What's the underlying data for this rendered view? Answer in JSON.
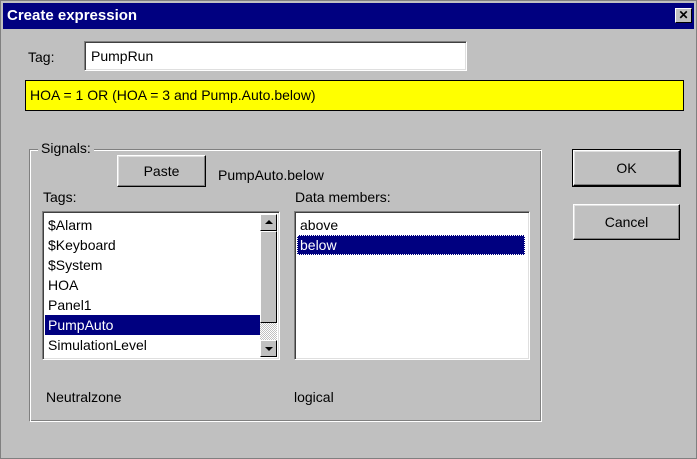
{
  "dialog": {
    "title": "Create expression",
    "close_glyph": "✕"
  },
  "tag": {
    "label": "Tag:",
    "value": "PumpRun"
  },
  "expression": {
    "value": "HOA = 1 OR (HOA = 3 and Pump.Auto.below)",
    "highlight_color": "#ffff00"
  },
  "signals": {
    "legend": "Signals:",
    "paste_label": "Paste",
    "paste_preview": "PumpAuto.below",
    "tags_label": "Tags:",
    "tags": [
      {
        "label": "$Alarm",
        "selected": false
      },
      {
        "label": "$Keyboard",
        "selected": false
      },
      {
        "label": "$System",
        "selected": false
      },
      {
        "label": "HOA",
        "selected": false
      },
      {
        "label": "Panel1",
        "selected": false
      },
      {
        "label": "PumpAuto",
        "selected": true
      },
      {
        "label": "SimulationLevel",
        "selected": false
      }
    ],
    "members_label": "Data members:",
    "members": [
      {
        "label": "above",
        "selected": false
      },
      {
        "label": "below",
        "selected": true
      }
    ],
    "tag_description": "Neutralzone",
    "member_type": "logical"
  },
  "buttons": {
    "ok": "OK",
    "cancel": "Cancel"
  },
  "colors": {
    "selection": "#000080",
    "face": "#c0c0c0"
  }
}
